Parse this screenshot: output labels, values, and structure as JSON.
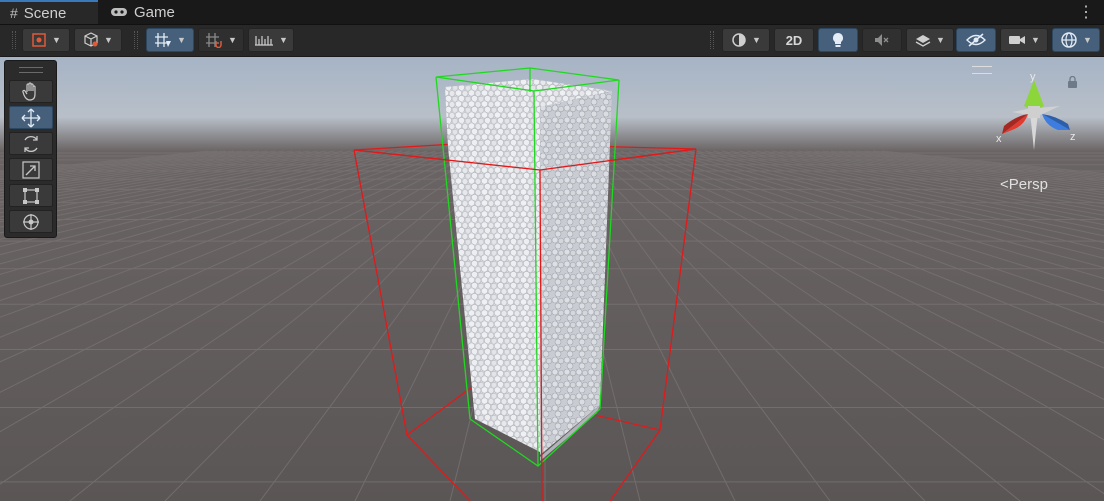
{
  "tabs": [
    {
      "label": "Scene",
      "icon": "hash-grid-icon",
      "active": true
    },
    {
      "label": "Game",
      "icon": "gamepad-icon",
      "active": false
    }
  ],
  "toolbar": {
    "toggle_2d_label": "2D"
  },
  "scene": {
    "projection_label": "Persp",
    "gizmo_axes": {
      "y": "y",
      "x": "x",
      "z": "z"
    }
  },
  "tools": [
    {
      "name": "hand-tool",
      "icon": "hand-icon",
      "active": false
    },
    {
      "name": "move-tool",
      "icon": "move-arrows-icon",
      "active": true
    },
    {
      "name": "rotate-tool",
      "icon": "rotate-icon",
      "active": false
    },
    {
      "name": "scale-tool",
      "icon": "scale-icon",
      "active": false
    },
    {
      "name": "rect-tool",
      "icon": "rect-transform-icon",
      "active": false
    },
    {
      "name": "transform-tool",
      "icon": "transform-icon",
      "active": false
    }
  ],
  "colors": {
    "accent": "#3a79bb",
    "toggle_on": "#46607c",
    "bounds_outer": "#e01a1a",
    "bounds_inner": "#1fd81f",
    "particles": "#e4e6ea",
    "ground": "#5e5959",
    "sky": "#a6b4c6"
  }
}
